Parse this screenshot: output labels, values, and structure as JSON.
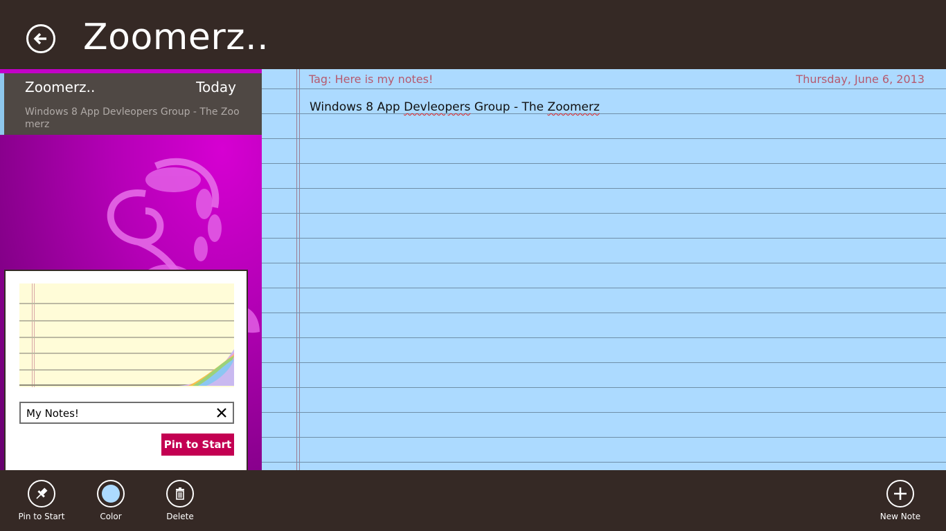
{
  "header": {
    "title": "Zoomerz..",
    "back_icon": "back-arrow-icon"
  },
  "note_list": {
    "items": [
      {
        "title": "Zoomerz..",
        "date": "Today",
        "preview": "Windows 8 App Devleopers Group - The Zoomerz",
        "selected": true
      }
    ]
  },
  "pin_flyout": {
    "tile_name_value": "My Notes!",
    "clear_icon": "close-icon",
    "pin_button_label": "Pin to Start"
  },
  "note": {
    "tag": "Tag: Here is my notes!",
    "date": "Thursday, June 6, 2013",
    "body_before_1": "Windows 8 App ",
    "body_misspelled_1": "Devleopers",
    "body_between": " Group - The ",
    "body_misspelled_2": "Zoomerz",
    "background_color": "#acdaff"
  },
  "appbar": {
    "left_buttons": [
      {
        "label": "Pin to Start",
        "icon": "pin-icon"
      },
      {
        "label": "Color",
        "icon": "color-swatch-icon"
      },
      {
        "label": "Delete",
        "icon": "trash-icon"
      }
    ],
    "right_buttons": [
      {
        "label": "New Note",
        "icon": "plus-icon"
      }
    ]
  },
  "colors": {
    "chrome": "#352925",
    "pin_accent": "#c30052",
    "tag_text": "#b65a6e",
    "list_accent": "#8ec7ec"
  }
}
